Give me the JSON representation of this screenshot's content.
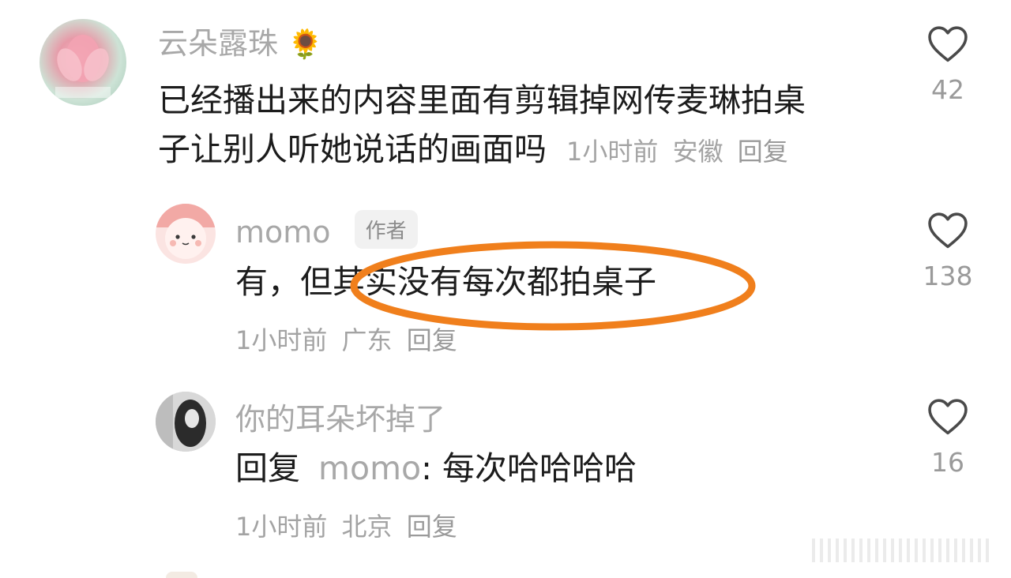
{
  "colors": {
    "highlight_ellipse": "#f07f1c",
    "username": "#a8a8a8",
    "body_text": "#1c1c1c",
    "meta_text": "#a3a3a3"
  },
  "comments": [
    {
      "username": "云朵露珠",
      "username_emoji": "🌻",
      "text_line1": "已经播出来的内容里面有剪辑掉网传麦琳拍桌",
      "text_line2": "子让别人听她说话的画面吗",
      "time": "1小时前",
      "location": "安徽",
      "reply_label": "回复",
      "like_icon": "heart-outline-icon",
      "like_count": "42"
    },
    {
      "username": "momo",
      "badge": "作者",
      "text": "有，但其实没有每次都拍桌子",
      "time": "1小时前",
      "location": "广东",
      "reply_label": "回复",
      "like_icon": "heart-outline-icon",
      "like_count": "138"
    },
    {
      "username": "你的耳朵坏掉了",
      "reply_prefix": "回复",
      "reply_target": "momo",
      "reply_text": ": 每次哈哈哈哈",
      "time": "1小时前",
      "location": "北京",
      "reply_label": "回复",
      "like_icon": "heart-outline-icon",
      "like_count": "16"
    }
  ]
}
